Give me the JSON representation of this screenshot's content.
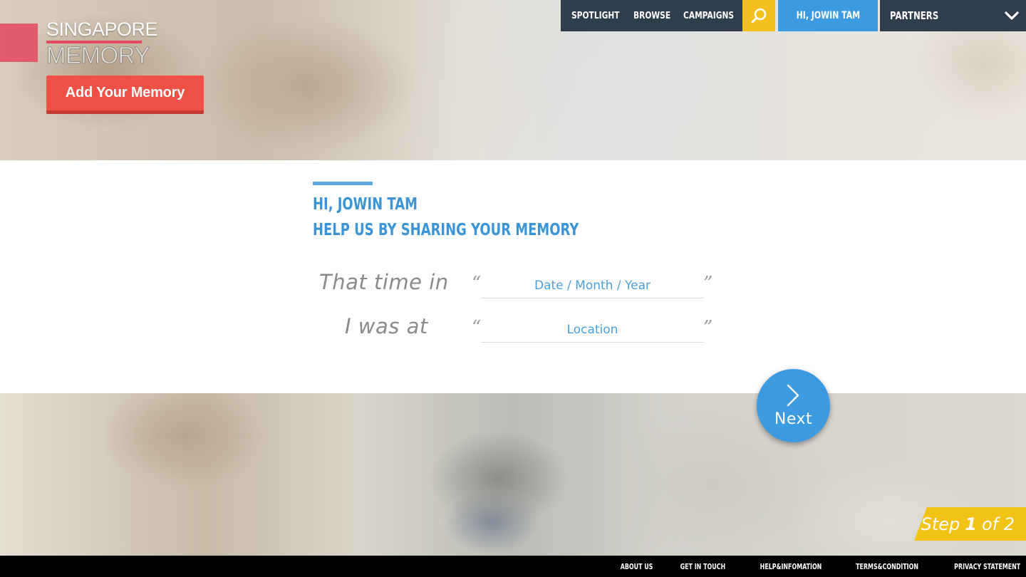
{
  "logo": {
    "line1": "SINGAPORE",
    "line2": "MEMORY"
  },
  "add_memory_button": "Add Your Memory",
  "nav": {
    "items": [
      "SPOTLIGHT",
      "BROWSE",
      "CAMPAIGNS"
    ],
    "search_icon": "search-icon",
    "user": "HI, JOWIN TAM",
    "partners": "PARTNERS"
  },
  "main": {
    "greeting": "HI, JOWIN TAM",
    "subheading": "HELP US BY SHARING YOUR MEMORY",
    "time_label": "That time in",
    "place_label": "I was at",
    "open_quote": "“",
    "close_quote": "”",
    "date_placeholder": "Date / Month / Year",
    "location_placeholder": "Location"
  },
  "next_button": "Next",
  "step": {
    "prefix": "Step",
    "current": "1",
    "of": "of",
    "total": "2"
  },
  "footer": {
    "links": [
      "ABOUT US",
      "GET IN TOUCH",
      "HELP&INFOMATION",
      "TERMS&CONDITION",
      "PRIVACY STATEMENT"
    ]
  },
  "colors": {
    "nav_dark": "#2f3d4d",
    "accent_blue": "#3c9be0",
    "search_yellow": "#f2bf1c",
    "brand_red": "#ef5146",
    "step_yellow": "#f2c215"
  }
}
